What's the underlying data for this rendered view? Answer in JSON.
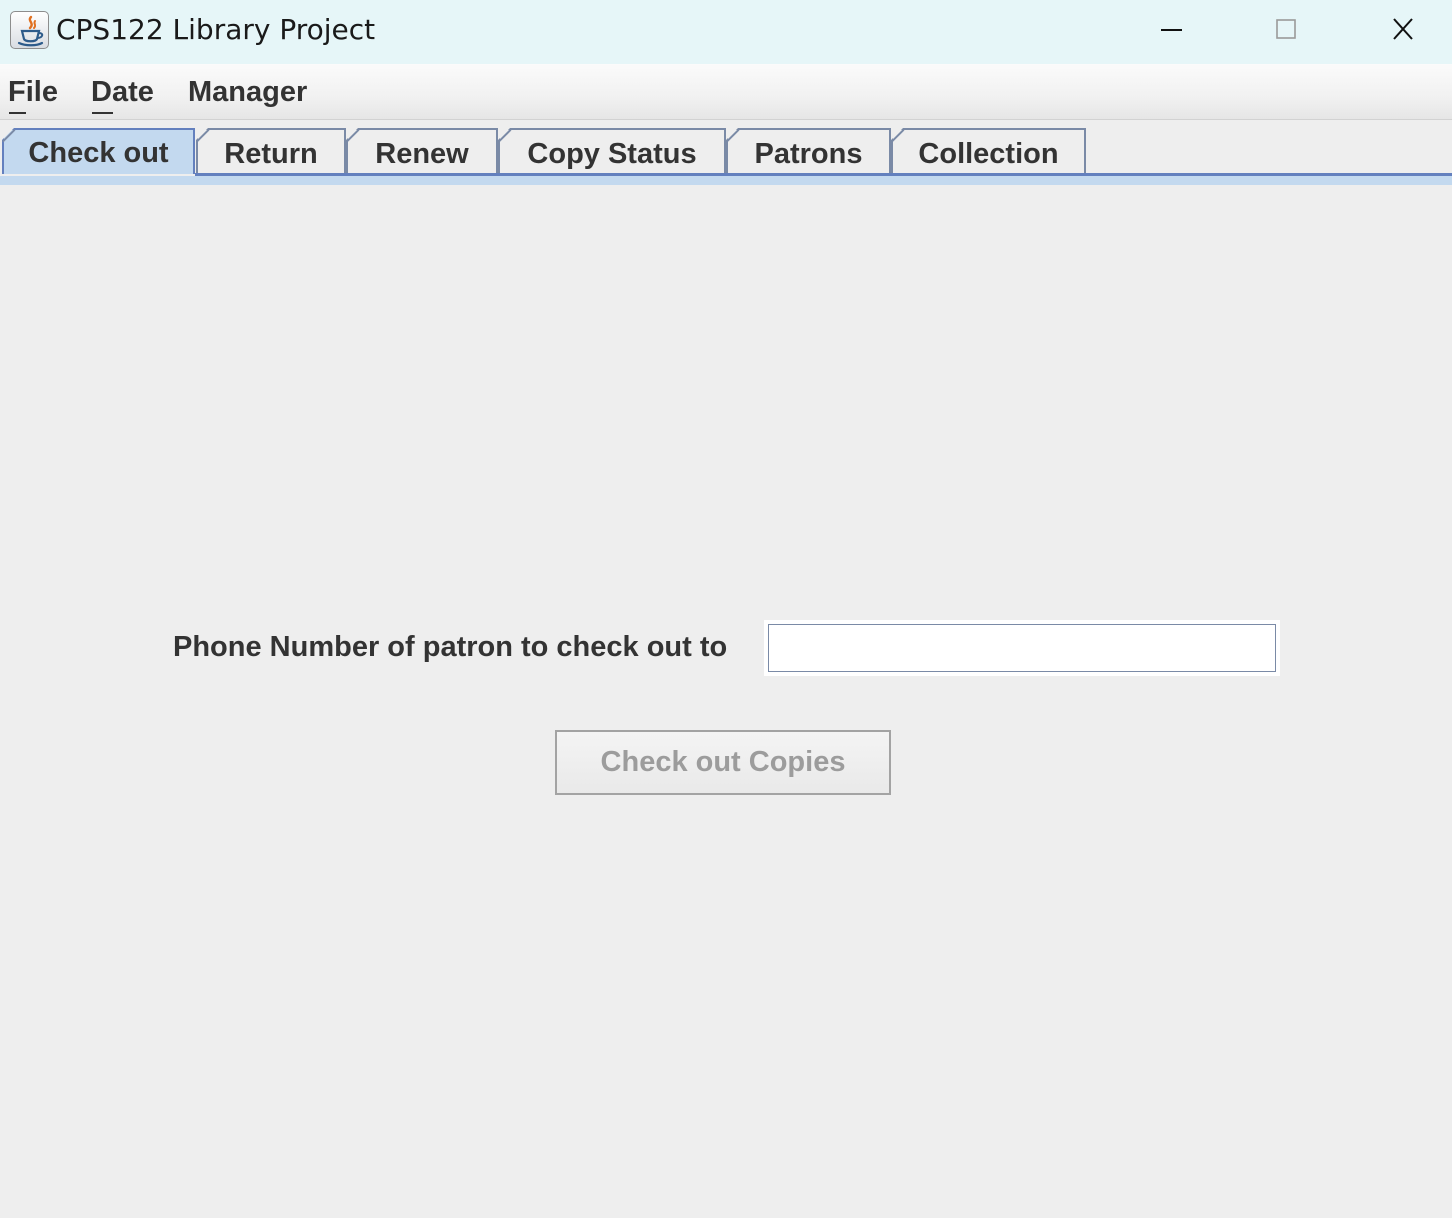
{
  "window": {
    "title": "CPS122 Library Project",
    "app_icon": "java-coffee-cup-icon",
    "controls": {
      "minimize_icon": "minimize-icon",
      "maximize_icon": "maximize-icon",
      "close_icon": "close-icon"
    }
  },
  "menubar": {
    "items": [
      {
        "label": "File",
        "mnemonic": "F"
      },
      {
        "label": "Date",
        "mnemonic": "D"
      },
      {
        "label": "Manager",
        "mnemonic": ""
      }
    ]
  },
  "tabs": {
    "selected": "Check out",
    "items": [
      {
        "label": "Check out"
      },
      {
        "label": "Return"
      },
      {
        "label": "Renew"
      },
      {
        "label": "Copy Status"
      },
      {
        "label": "Patrons"
      },
      {
        "label": "Collection"
      }
    ]
  },
  "checkout": {
    "phone_label": "Phone Number of patron to check out to",
    "phone_value": "",
    "button_label": "Check out Copies",
    "button_enabled": false
  },
  "colors": {
    "titlebar_bg": "#e6f6f8",
    "panel_bg": "#eeeeee",
    "tab_selected_bg": "#c3d9ef",
    "tab_border": "#7a8aa6",
    "text": "#333333",
    "disabled_text": "#9c9c9c"
  }
}
